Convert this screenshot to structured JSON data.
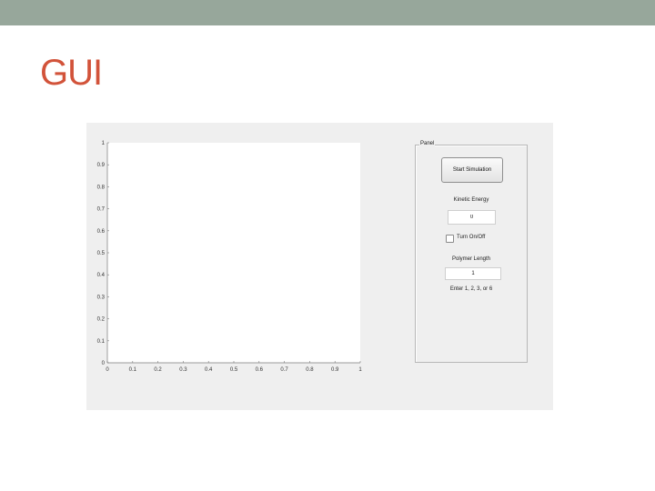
{
  "slide": {
    "title": "GUI"
  },
  "colors": {
    "top_band": "#97a79b",
    "title": "#d2533a",
    "window_bg": "#efefef"
  },
  "axes": {
    "x_ticks": [
      "0",
      "0.1",
      "0.2",
      "0.3",
      "0.4",
      "0.5",
      "0.6",
      "0.7",
      "0.8",
      "0.9",
      "1"
    ],
    "y_ticks": [
      "0",
      "0.1",
      "0.2",
      "0.3",
      "0.4",
      "0.5",
      "0.6",
      "0.7",
      "0.8",
      "0.9",
      "1"
    ],
    "xlim": [
      0,
      1
    ],
    "ylim": [
      0,
      1
    ]
  },
  "panel": {
    "title": "Panel",
    "start_button": "Start Simulation",
    "kinetic_label": "Kinetic Energy",
    "kinetic_value": "0",
    "toggle_label": "Turn On/Off",
    "toggle_checked": false,
    "polymer_label": "Polymer Length",
    "polymer_value": "1",
    "polymer_hint": "Enter 1, 2, 3, or 6"
  }
}
